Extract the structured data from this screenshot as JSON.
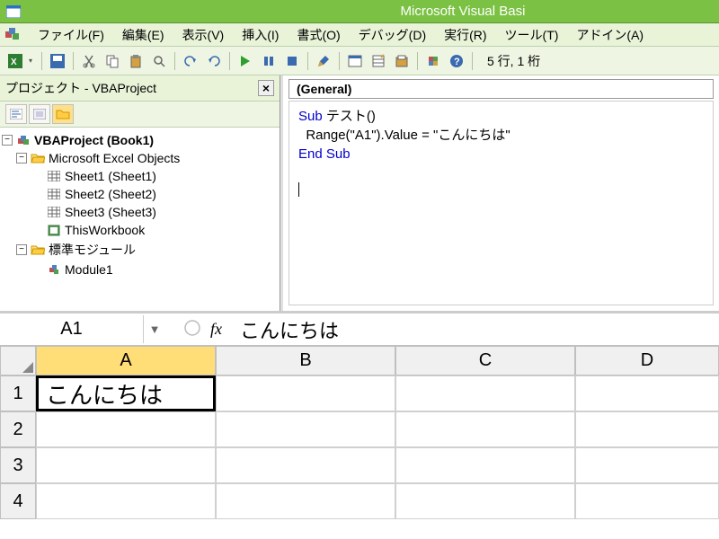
{
  "title": "Microsoft Visual Basi",
  "menu": {
    "file": "ファイル(F)",
    "edit": "編集(E)",
    "view": "表示(V)",
    "insert": "挿入(I)",
    "format": "書式(O)",
    "debug": "デバッグ(D)",
    "run": "実行(R)",
    "tools": "ツール(T)",
    "addins": "アドイン(A)"
  },
  "toolbar": {
    "position": "5 行, 1 桁"
  },
  "project": {
    "title": "プロジェクト - VBAProject",
    "root": "VBAProject (Book1)",
    "excelObjects": "Microsoft Excel Objects",
    "sheet1": "Sheet1 (Sheet1)",
    "sheet2": "Sheet2 (Sheet2)",
    "sheet3": "Sheet3 (Sheet3)",
    "thisWorkbook": "ThisWorkbook",
    "modulesFolder": "標準モジュール",
    "module1": "Module1"
  },
  "code": {
    "section": "(General)",
    "line1a": "Sub",
    "line1b": " テスト()",
    "line2": "  Range(\"A1\").Value = \"こんにちは\"",
    "line3": "End Sub"
  },
  "excel": {
    "namebox": "A1",
    "fxLabel": "fx",
    "fxValue": "こんにちは",
    "cols": {
      "A": "A",
      "B": "B",
      "C": "C",
      "D": "D"
    },
    "rows": {
      "1": "1",
      "2": "2",
      "3": "3",
      "4": "4"
    },
    "A1": "こんにちは"
  }
}
